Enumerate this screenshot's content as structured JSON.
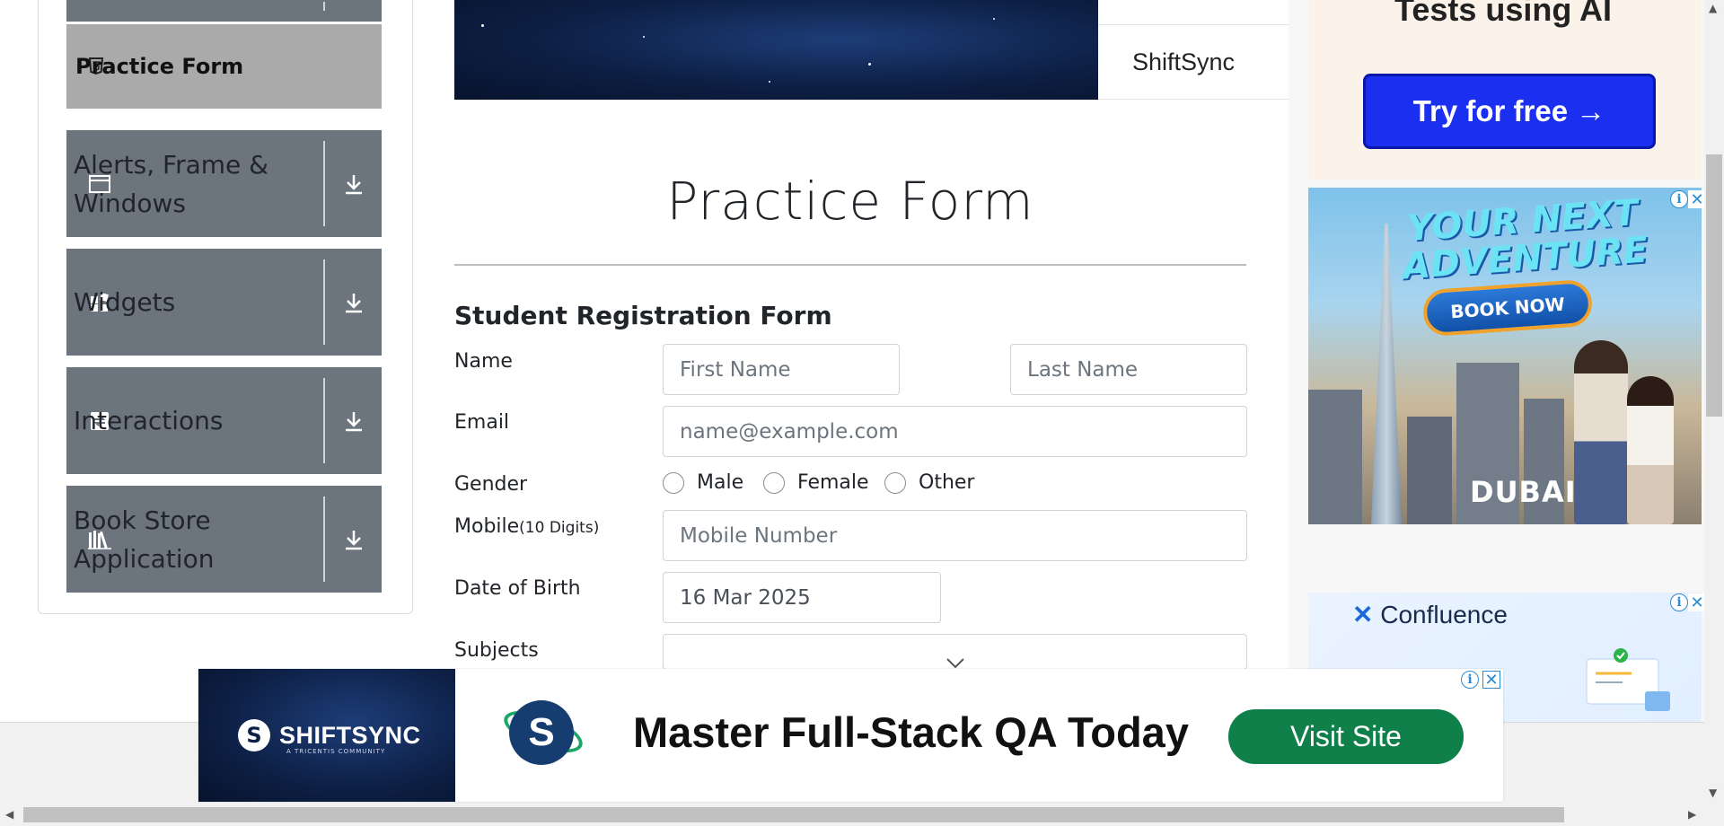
{
  "sidebar": {
    "active_item": "Practice Form",
    "items": [
      {
        "label": "Alerts, Frame & Windows",
        "icon": "window-icon"
      },
      {
        "label": "Widgets",
        "icon": "widgets-icon"
      },
      {
        "label": "Interactions",
        "icon": "interactions-icon"
      },
      {
        "label": "Book Store Application",
        "icon": "books-icon"
      }
    ]
  },
  "header": {
    "banner_side_text": "ShiftSync"
  },
  "form": {
    "title": "Practice Form",
    "subtitle": "Student Registration Form",
    "name_label": "Name",
    "first_name_placeholder": "First Name",
    "last_name_placeholder": "Last Name",
    "email_label": "Email",
    "email_placeholder": "name@example.com",
    "gender_label": "Gender",
    "gender_options": [
      "Male",
      "Female",
      "Other"
    ],
    "mobile_label": "Mobile",
    "mobile_hint": "(10 Digits)",
    "mobile_placeholder": "Mobile Number",
    "dob_label": "Date of Birth",
    "dob_value": "16 Mar 2025",
    "subjects_label": "Subjects"
  },
  "ads": {
    "top_text": "Tests using AI",
    "top_button": "Try for free →",
    "dubai_headline": "YOUR NEXT ADVENTURE",
    "dubai_button": "BOOK NOW",
    "dubai_logo": "DUBAI",
    "confluence_title": "Confluence",
    "bottom_brand": "SHIFTSYNC",
    "bottom_brand_sub": "A TRICENTIS COMMUNITY",
    "bottom_headline": "Master Full-Stack QA Today",
    "bottom_button": "Visit Site"
  },
  "colors": {
    "sidebar_button": "#6c757d",
    "sidebar_active": "#aaaaaa",
    "visit_button": "#10804a",
    "try_button": "#1a2ff0"
  }
}
